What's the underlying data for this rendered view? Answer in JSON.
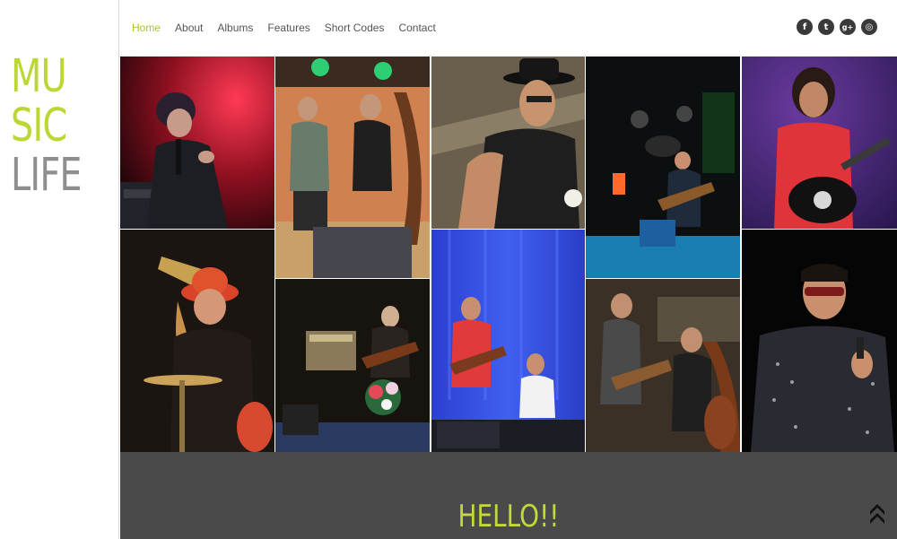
{
  "logo": {
    "line1": "MU",
    "line2": "SIC",
    "line3": "LIFE"
  },
  "nav": {
    "items": [
      {
        "label": "Home",
        "active": true
      },
      {
        "label": "About",
        "active": false
      },
      {
        "label": "Albums",
        "active": false
      },
      {
        "label": "Features",
        "active": false
      },
      {
        "label": "Short Codes",
        "active": false
      },
      {
        "label": "Contact",
        "active": false
      }
    ]
  },
  "social": [
    {
      "name": "facebook-icon",
      "glyph": "f"
    },
    {
      "name": "twitter-icon",
      "glyph": "t"
    },
    {
      "name": "google-plus-icon",
      "glyph": "g+"
    },
    {
      "name": "dribbble-icon",
      "glyph": "◎"
    }
  ],
  "gallery": {
    "photos": [
      {
        "name": "photo-singer-red-stage"
      },
      {
        "name": "photo-duo-outdoor-stage"
      },
      {
        "name": "photo-man-black-hat"
      },
      {
        "name": "photo-band-on-stage"
      },
      {
        "name": "photo-guitarist-red-shirt"
      },
      {
        "name": "photo-drummer-hat"
      },
      {
        "name": "photo-guitarist-flowers"
      },
      {
        "name": "photo-guitarist-blue-curtain"
      },
      {
        "name": "photo-trio-double-bass"
      },
      {
        "name": "photo-singer-sunglasses"
      }
    ]
  },
  "hello_section": {
    "heading": "HELLO!!"
  },
  "colors": {
    "accent": "#bcd634",
    "dark_band": "#4a4a4a",
    "logo_gray": "#8e8e8e"
  }
}
